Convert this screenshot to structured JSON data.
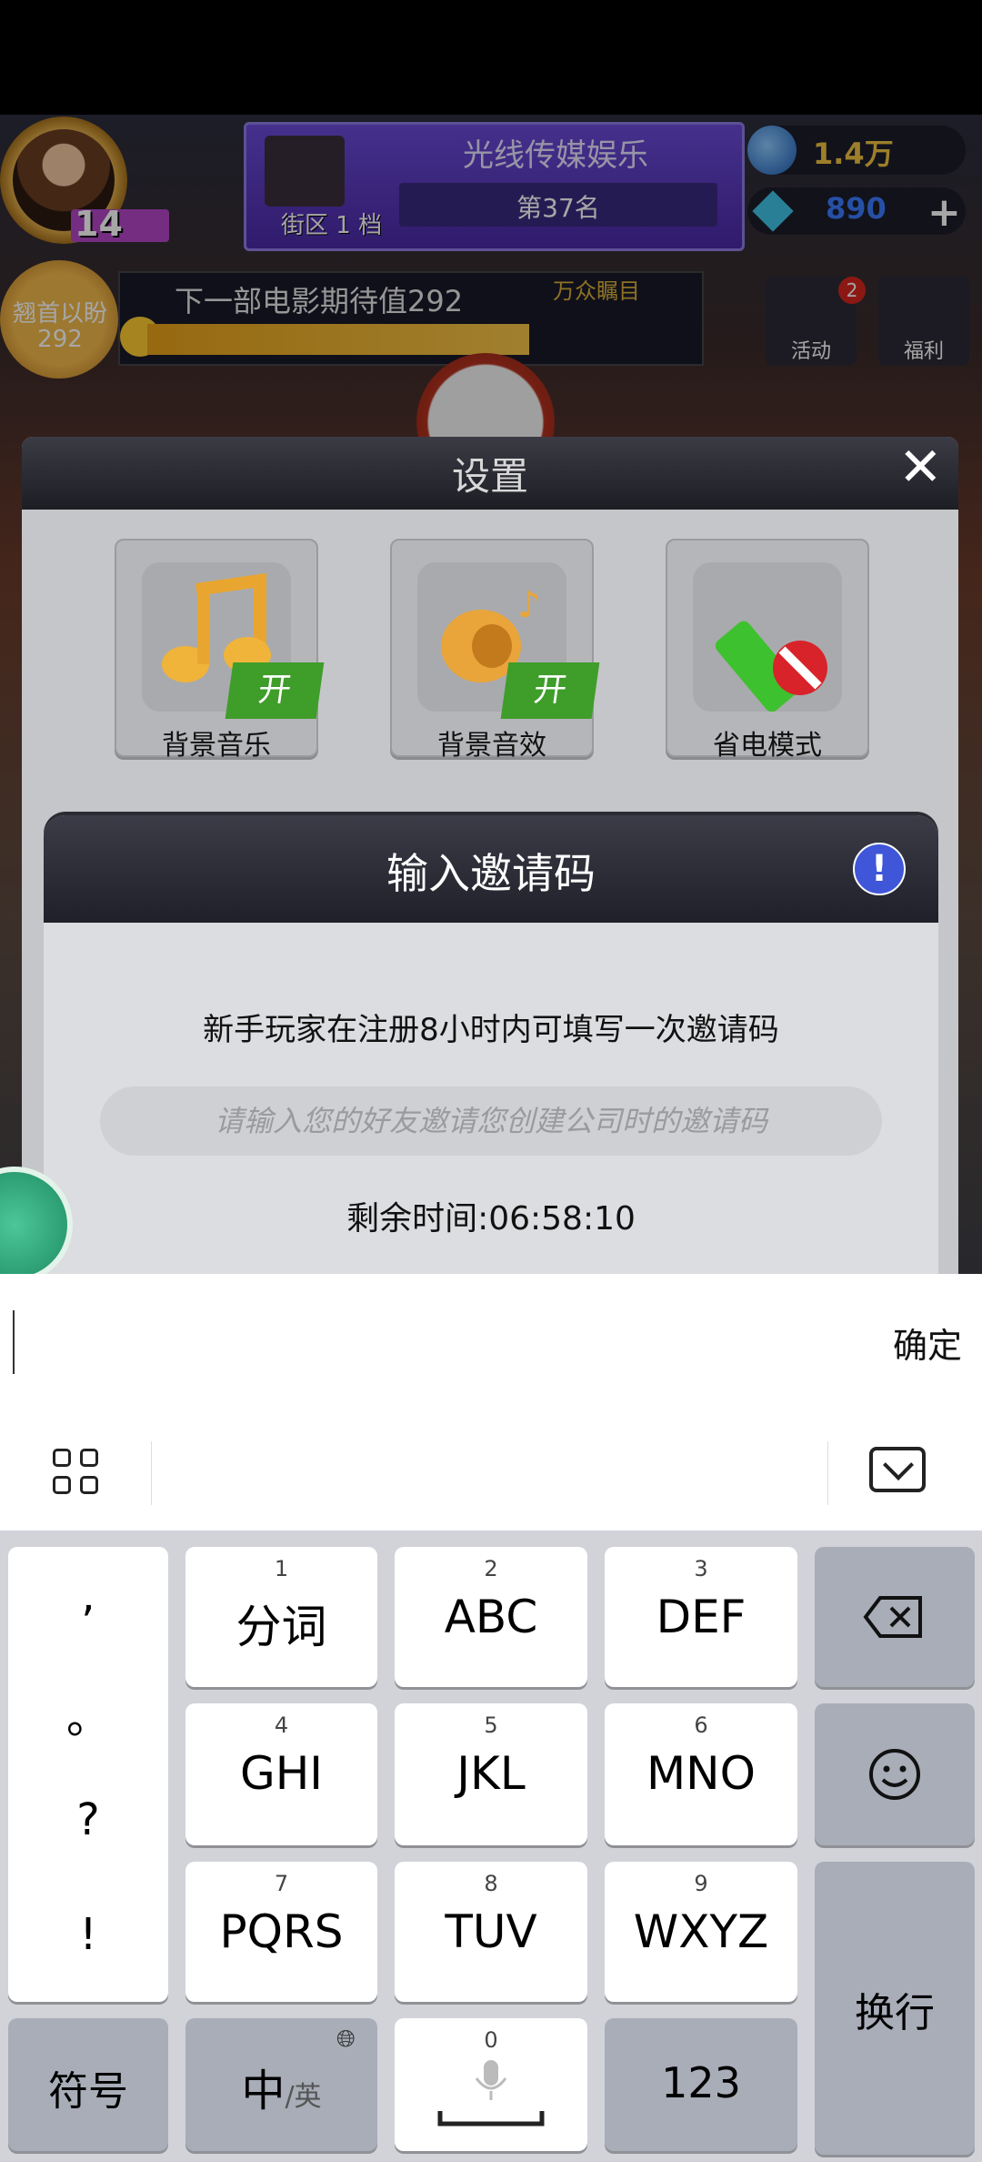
{
  "hud": {
    "level": "14",
    "district_name": "光线传媒娱乐",
    "district_level": "街区 1 档",
    "rank": "第37名",
    "coins": "1.4万",
    "gems": "890",
    "medal_label": "翘首以盼",
    "medal_value": "292",
    "expectation_text": "下一部电影期待值292",
    "crowd_text": "万众瞩目",
    "activity_label": "活动",
    "activity_badge": "2",
    "welfare_label": "福利"
  },
  "settings": {
    "title": "设置",
    "items": [
      {
        "label": "背景音乐",
        "state": "开"
      },
      {
        "label": "背景音效",
        "state": "开"
      },
      {
        "label": "省电模式",
        "state": ""
      }
    ]
  },
  "invite": {
    "title": "输入邀请码",
    "description": "新手玩家在注册8小时内可填写一次邀请码",
    "placeholder": "请输入您的好友邀请您创建公司时的邀请码",
    "timer": "剩余时间:06:58:10"
  },
  "ime": {
    "confirm": "确定"
  },
  "keyboard": {
    "punctuation": [
      ",",
      "。",
      "?",
      "!"
    ],
    "row1": [
      {
        "num": "1",
        "label": "分词"
      },
      {
        "num": "2",
        "label": "ABC"
      },
      {
        "num": "3",
        "label": "DEF"
      }
    ],
    "row2": [
      {
        "num": "4",
        "label": "GHI"
      },
      {
        "num": "5",
        "label": "JKL"
      },
      {
        "num": "6",
        "label": "MNO"
      }
    ],
    "row3": [
      {
        "num": "7",
        "label": "PQRS"
      },
      {
        "num": "8",
        "label": "TUV"
      },
      {
        "num": "9",
        "label": "WXYZ"
      }
    ],
    "symbols": "符号",
    "lang_main": "中",
    "lang_alt": "/英",
    "space_num": "0",
    "numbers": "123",
    "newline": "换行"
  },
  "colors": {
    "on_tag": "#3f9d2a",
    "info": "#3f56d8",
    "key_gray": "#a8adb8"
  }
}
